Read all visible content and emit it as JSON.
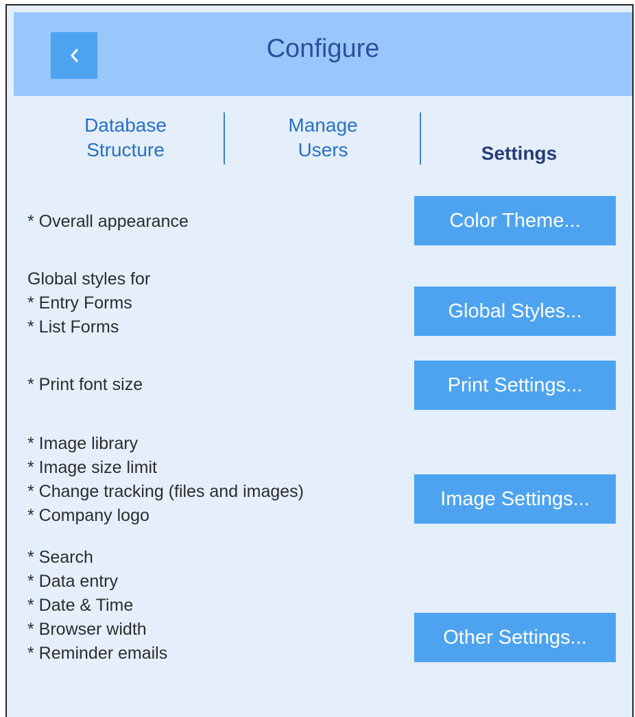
{
  "header": {
    "title": "Configure",
    "back_icon": "chevron-left-icon"
  },
  "tabs": [
    {
      "label": "Database\nStructure",
      "active": false
    },
    {
      "label": "Manage\nUsers",
      "active": false
    },
    {
      "label": "Settings",
      "active": true
    }
  ],
  "settings": [
    {
      "description": "* Overall appearance",
      "button": "Color Theme..."
    },
    {
      "description": "Global styles for\n* Entry Forms\n* List Forms",
      "button": "Global Styles..."
    },
    {
      "description": "* Print font size",
      "button": "Print Settings..."
    },
    {
      "description": "* Image library\n* Image size limit\n* Change tracking (files and images)\n* Company logo",
      "button": "Image Settings..."
    },
    {
      "description": "* Search\n* Data entry\n* Date & Time\n* Browser width\n* Reminder emails",
      "button": "Other Settings..."
    }
  ],
  "colors": {
    "background": "#e4effb",
    "header": "#99c7fb",
    "button": "#4da3f0",
    "title": "#2a4f9e",
    "tab_link": "#2a6ec9",
    "tab_active": "#273c7a"
  }
}
